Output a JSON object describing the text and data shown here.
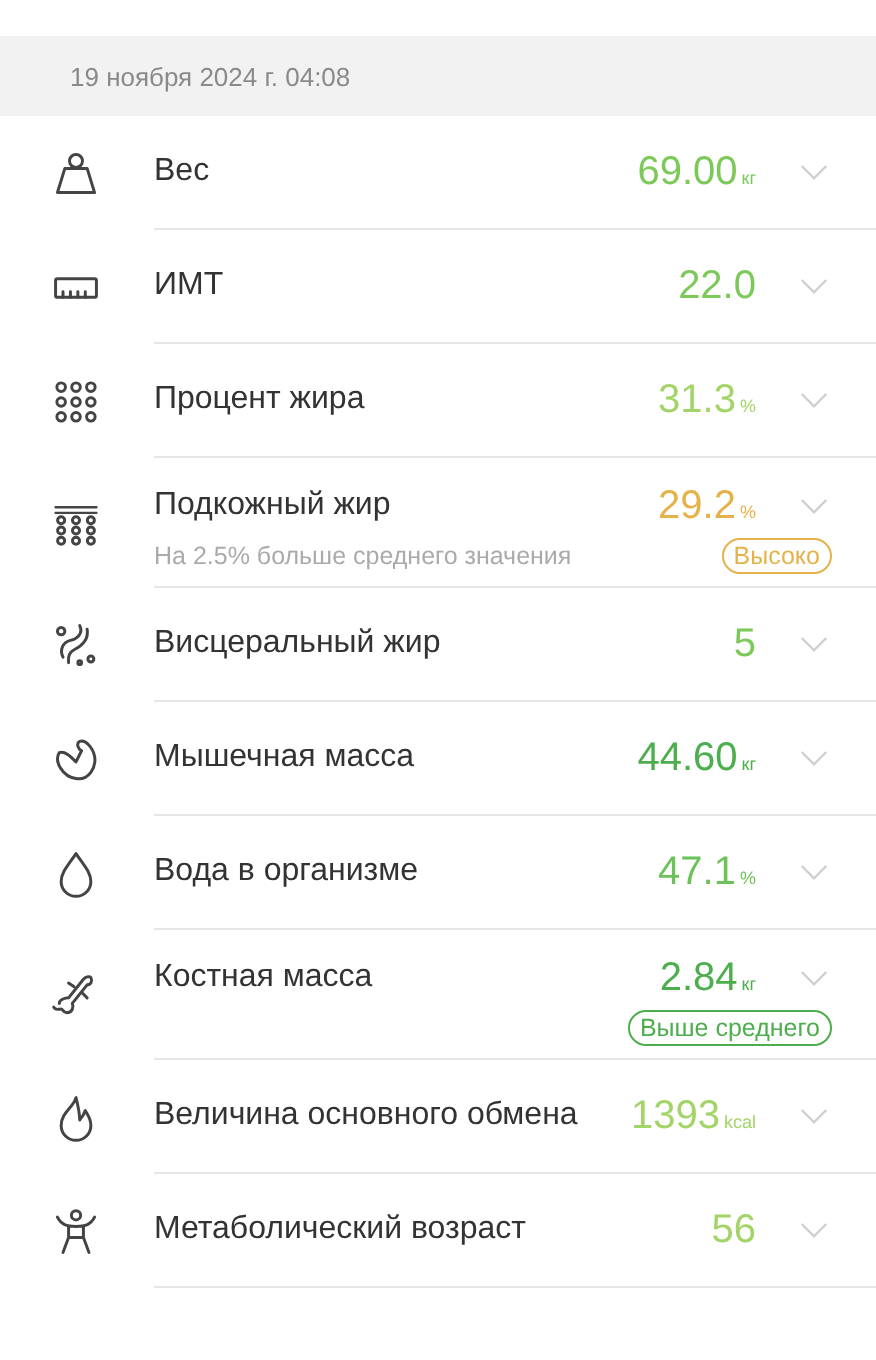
{
  "date": "19 ноября 2024 г. 04:08",
  "items": [
    {
      "label": "Вес",
      "value": "69.00",
      "unit": "кг",
      "color": "#7cc95a"
    },
    {
      "label": "ИМТ",
      "value": "22.0",
      "color": "#7cc95a"
    },
    {
      "label": "Процент жира",
      "value": "31.3",
      "unit": "%",
      "color": "#a3d468"
    },
    {
      "label": "Подкожный жир",
      "value": "29.2",
      "unit": "%",
      "color": "#e5b24a",
      "note": "На 2.5% больше среднего значения",
      "badge": {
        "text": "Высоко",
        "color": "#e5b24a"
      }
    },
    {
      "label": "Висцеральный жир",
      "value": "5",
      "color": "#7cc95a"
    },
    {
      "label": "Мышечная масса",
      "value": "44.60",
      "unit": "кг",
      "color": "#4cae4c"
    },
    {
      "label": "Вода в организме",
      "value": "47.1",
      "unit": "%",
      "color": "#6cc25a"
    },
    {
      "label": "Костная масса",
      "value": "2.84",
      "unit": "кг",
      "color": "#4cae4c",
      "badge": {
        "text": "Выше среднего",
        "color": "#4cae4c"
      }
    },
    {
      "label": "Величина основного обмена",
      "value": "1393",
      "unit": "kcal",
      "color": "#a3d468"
    },
    {
      "label": "Метаболический возраст",
      "value": "56",
      "color": "#a3d468"
    }
  ]
}
